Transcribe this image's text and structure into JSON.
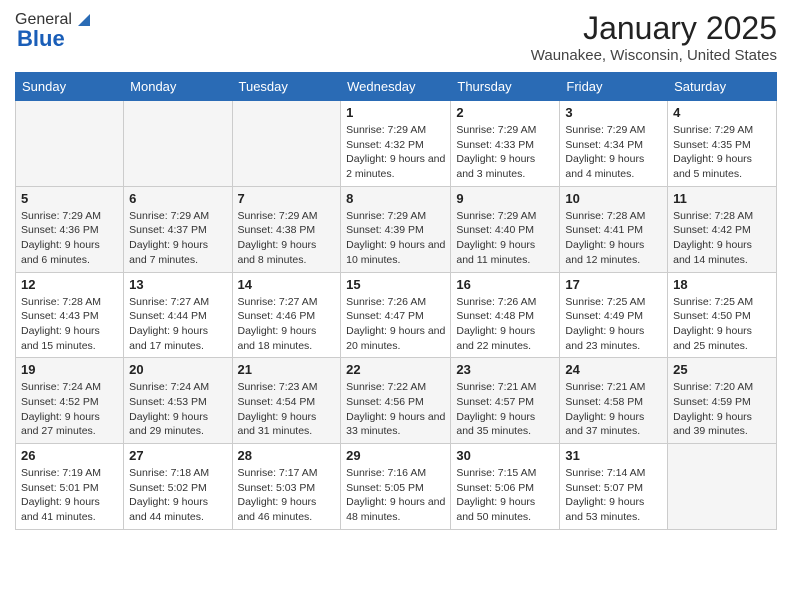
{
  "header": {
    "logo_general": "General",
    "logo_blue": "Blue",
    "month": "January 2025",
    "location": "Waunakee, Wisconsin, United States"
  },
  "days_of_week": [
    "Sunday",
    "Monday",
    "Tuesday",
    "Wednesday",
    "Thursday",
    "Friday",
    "Saturday"
  ],
  "weeks": [
    [
      {
        "day": "",
        "info": ""
      },
      {
        "day": "",
        "info": ""
      },
      {
        "day": "",
        "info": ""
      },
      {
        "day": "1",
        "info": "Sunrise: 7:29 AM\nSunset: 4:32 PM\nDaylight: 9 hours and 2 minutes."
      },
      {
        "day": "2",
        "info": "Sunrise: 7:29 AM\nSunset: 4:33 PM\nDaylight: 9 hours and 3 minutes."
      },
      {
        "day": "3",
        "info": "Sunrise: 7:29 AM\nSunset: 4:34 PM\nDaylight: 9 hours and 4 minutes."
      },
      {
        "day": "4",
        "info": "Sunrise: 7:29 AM\nSunset: 4:35 PM\nDaylight: 9 hours and 5 minutes."
      }
    ],
    [
      {
        "day": "5",
        "info": "Sunrise: 7:29 AM\nSunset: 4:36 PM\nDaylight: 9 hours and 6 minutes."
      },
      {
        "day": "6",
        "info": "Sunrise: 7:29 AM\nSunset: 4:37 PM\nDaylight: 9 hours and 7 minutes."
      },
      {
        "day": "7",
        "info": "Sunrise: 7:29 AM\nSunset: 4:38 PM\nDaylight: 9 hours and 8 minutes."
      },
      {
        "day": "8",
        "info": "Sunrise: 7:29 AM\nSunset: 4:39 PM\nDaylight: 9 hours and 10 minutes."
      },
      {
        "day": "9",
        "info": "Sunrise: 7:29 AM\nSunset: 4:40 PM\nDaylight: 9 hours and 11 minutes."
      },
      {
        "day": "10",
        "info": "Sunrise: 7:28 AM\nSunset: 4:41 PM\nDaylight: 9 hours and 12 minutes."
      },
      {
        "day": "11",
        "info": "Sunrise: 7:28 AM\nSunset: 4:42 PM\nDaylight: 9 hours and 14 minutes."
      }
    ],
    [
      {
        "day": "12",
        "info": "Sunrise: 7:28 AM\nSunset: 4:43 PM\nDaylight: 9 hours and 15 minutes."
      },
      {
        "day": "13",
        "info": "Sunrise: 7:27 AM\nSunset: 4:44 PM\nDaylight: 9 hours and 17 minutes."
      },
      {
        "day": "14",
        "info": "Sunrise: 7:27 AM\nSunset: 4:46 PM\nDaylight: 9 hours and 18 minutes."
      },
      {
        "day": "15",
        "info": "Sunrise: 7:26 AM\nSunset: 4:47 PM\nDaylight: 9 hours and 20 minutes."
      },
      {
        "day": "16",
        "info": "Sunrise: 7:26 AM\nSunset: 4:48 PM\nDaylight: 9 hours and 22 minutes."
      },
      {
        "day": "17",
        "info": "Sunrise: 7:25 AM\nSunset: 4:49 PM\nDaylight: 9 hours and 23 minutes."
      },
      {
        "day": "18",
        "info": "Sunrise: 7:25 AM\nSunset: 4:50 PM\nDaylight: 9 hours and 25 minutes."
      }
    ],
    [
      {
        "day": "19",
        "info": "Sunrise: 7:24 AM\nSunset: 4:52 PM\nDaylight: 9 hours and 27 minutes."
      },
      {
        "day": "20",
        "info": "Sunrise: 7:24 AM\nSunset: 4:53 PM\nDaylight: 9 hours and 29 minutes."
      },
      {
        "day": "21",
        "info": "Sunrise: 7:23 AM\nSunset: 4:54 PM\nDaylight: 9 hours and 31 minutes."
      },
      {
        "day": "22",
        "info": "Sunrise: 7:22 AM\nSunset: 4:56 PM\nDaylight: 9 hours and 33 minutes."
      },
      {
        "day": "23",
        "info": "Sunrise: 7:21 AM\nSunset: 4:57 PM\nDaylight: 9 hours and 35 minutes."
      },
      {
        "day": "24",
        "info": "Sunrise: 7:21 AM\nSunset: 4:58 PM\nDaylight: 9 hours and 37 minutes."
      },
      {
        "day": "25",
        "info": "Sunrise: 7:20 AM\nSunset: 4:59 PM\nDaylight: 9 hours and 39 minutes."
      }
    ],
    [
      {
        "day": "26",
        "info": "Sunrise: 7:19 AM\nSunset: 5:01 PM\nDaylight: 9 hours and 41 minutes."
      },
      {
        "day": "27",
        "info": "Sunrise: 7:18 AM\nSunset: 5:02 PM\nDaylight: 9 hours and 44 minutes."
      },
      {
        "day": "28",
        "info": "Sunrise: 7:17 AM\nSunset: 5:03 PM\nDaylight: 9 hours and 46 minutes."
      },
      {
        "day": "29",
        "info": "Sunrise: 7:16 AM\nSunset: 5:05 PM\nDaylight: 9 hours and 48 minutes."
      },
      {
        "day": "30",
        "info": "Sunrise: 7:15 AM\nSunset: 5:06 PM\nDaylight: 9 hours and 50 minutes."
      },
      {
        "day": "31",
        "info": "Sunrise: 7:14 AM\nSunset: 5:07 PM\nDaylight: 9 hours and 53 minutes."
      },
      {
        "day": "",
        "info": ""
      }
    ]
  ]
}
